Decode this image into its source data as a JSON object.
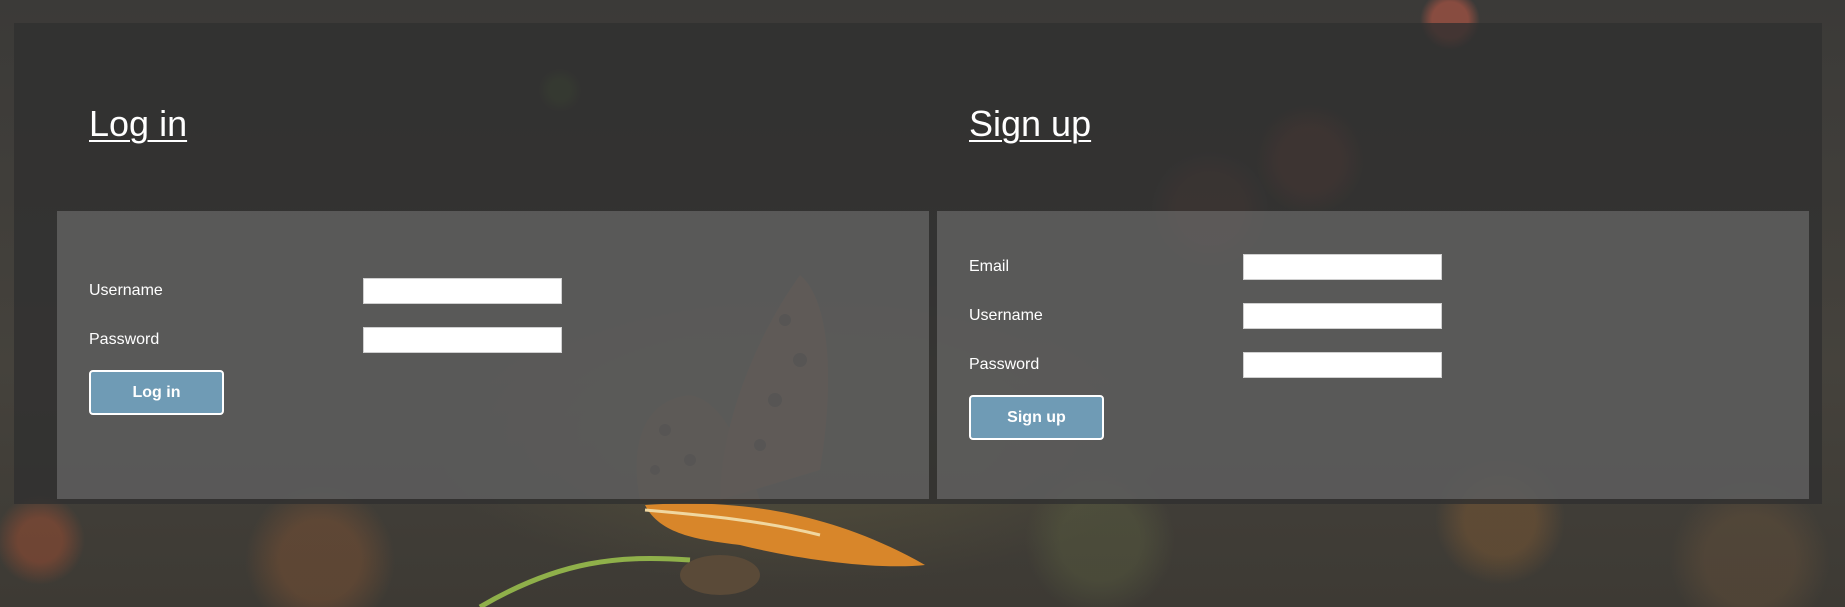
{
  "login": {
    "title": "Log in",
    "username_label": "Username",
    "username_value": "",
    "password_label": "Password",
    "password_value": "",
    "button_label": "Log in"
  },
  "signup": {
    "title": "Sign up",
    "email_label": "Email",
    "email_value": "",
    "username_label": "Username",
    "username_value": "",
    "password_label": "Password",
    "password_value": "",
    "button_label": "Sign up"
  },
  "colors": {
    "button_bg": "#6f9bb5",
    "overlay": "#303030",
    "panel": "#787878",
    "text": "#ffffff"
  },
  "background": {
    "subject": "butterfly-on-flower-photo"
  }
}
